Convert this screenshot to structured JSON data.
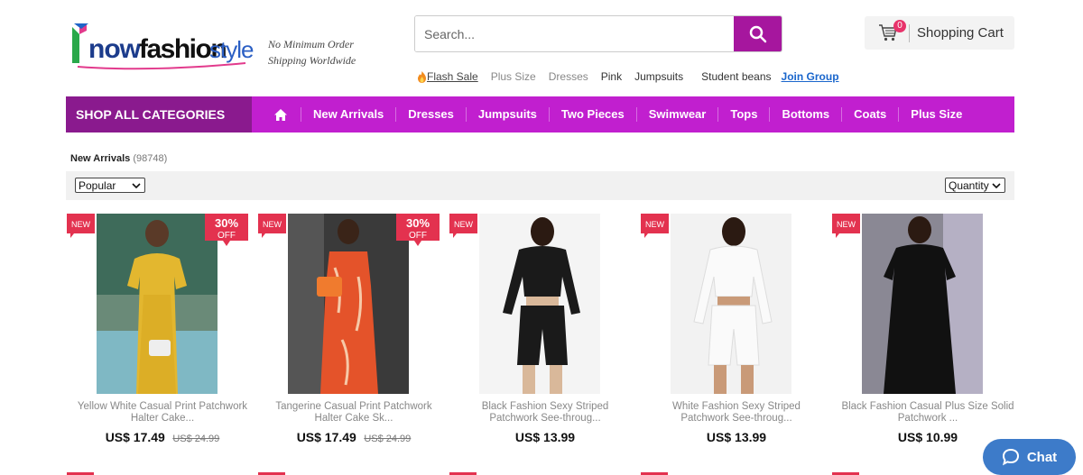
{
  "header": {
    "tagline_line1": "No Minimum Order",
    "tagline_line2": "Shipping Worldwide",
    "logo_text": "Know fashion style",
    "search_placeholder": "Search...",
    "cart_count": "0",
    "cart_label": "Shopping Cart",
    "quick_links": {
      "flash_sale": "Flash Sale",
      "plus_size": "Plus Size",
      "dresses": "Dresses",
      "pink": "Pink",
      "jumpsuits": "Jumpsuits",
      "student_beans": "Student beans",
      "join_group": "Join Group"
    }
  },
  "nav": {
    "shop_all": "SHOP ALL CATEGORIES",
    "items": [
      "New Arrivals",
      "Dresses",
      "Jumpsuits",
      "Two Pieces",
      "Swimwear",
      "Tops",
      "Bottoms",
      "Coats",
      "Plus Size"
    ]
  },
  "listing": {
    "title": "New Arrivals",
    "count": "(98748)",
    "sort_value": "Popular",
    "per_page_value": "Quantity"
  },
  "products": [
    {
      "title_l1": "Yellow White Casual Print Patchwork",
      "title_l2": "Halter Cake...",
      "price": "US$ 17.49",
      "old_price": "US$ 24.99",
      "badge": "NEW",
      "discount_pct": "30%",
      "discount_word": "OFF"
    },
    {
      "title_l1": "Tangerine Casual Print Patchwork",
      "title_l2": "Halter Cake Sk...",
      "price": "US$ 17.49",
      "old_price": "US$ 24.99",
      "badge": "NEW",
      "discount_pct": "30%",
      "discount_word": "OFF"
    },
    {
      "title_l1": "Black Fashion Sexy Striped",
      "title_l2": "Patchwork See-throug...",
      "price": "US$ 13.99",
      "badge": "NEW"
    },
    {
      "title_l1": "White Fashion Sexy Striped",
      "title_l2": "Patchwork See-throug...",
      "price": "US$ 13.99",
      "badge": "NEW"
    },
    {
      "title_l1": "Black Fashion Casual Plus Size Solid",
      "title_l2": "Patchwork ...",
      "price": "US$ 10.99",
      "badge": "NEW"
    }
  ],
  "chat": {
    "label": "Chat"
  },
  "colors": {
    "brand_purple": "#c11fcf",
    "dark_purple": "#8a1a8e",
    "button_purple": "#a6169e",
    "tag_red": "#e3324f",
    "chat_blue": "#3d7bc9"
  }
}
